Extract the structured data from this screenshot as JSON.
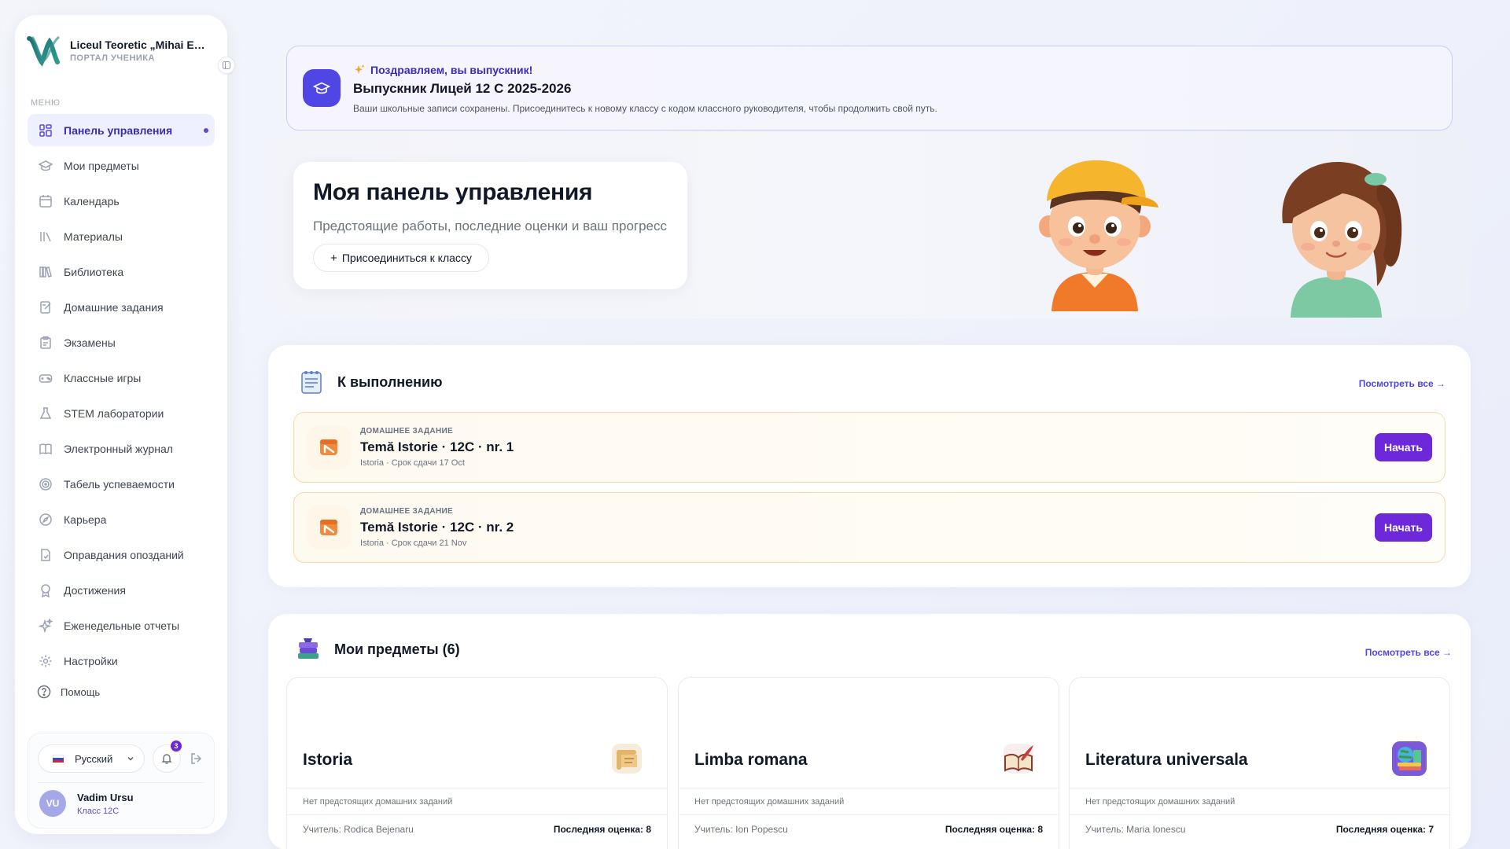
{
  "sidebar": {
    "school_name": "Liceul Teoretic „Mihai Emi...",
    "portal_label": "ПОРТАЛ УЧЕНИКА",
    "menu_label": "МЕНЮ",
    "items": [
      {
        "label": "Панель управления",
        "icon": "dashboard-icon",
        "active": true
      },
      {
        "label": "Мои предметы",
        "icon": "graduation-cap-icon"
      },
      {
        "label": "Календарь",
        "icon": "calendar-icon"
      },
      {
        "label": "Материалы",
        "icon": "materials-icon"
      },
      {
        "label": "Библиотека",
        "icon": "library-icon"
      },
      {
        "label": "Домашние задания",
        "icon": "homework-icon"
      },
      {
        "label": "Экзамены",
        "icon": "clipboard-icon"
      },
      {
        "label": "Классные игры",
        "icon": "gamepad-icon"
      },
      {
        "label": "STEM лаборатории",
        "icon": "flask-icon"
      },
      {
        "label": "Электронный журнал",
        "icon": "book-open-icon"
      },
      {
        "label": "Табель успеваемости",
        "icon": "target-icon"
      },
      {
        "label": "Карьера",
        "icon": "compass-icon"
      },
      {
        "label": "Оправдания опозданий",
        "icon": "document-icon"
      },
      {
        "label": "Достижения",
        "icon": "award-icon"
      },
      {
        "label": "Еженедельные отчеты",
        "icon": "sparkles-icon"
      },
      {
        "label": "Настройки",
        "icon": "gear-icon"
      }
    ],
    "help_label": "Помощь",
    "language": "Русский",
    "notification_count": "3",
    "user": {
      "initials": "VU",
      "name": "Vadim Ursu",
      "class": "Класс 12C"
    }
  },
  "graduation_banner": {
    "congrats": "Поздравляем, вы выпускник!",
    "title": "Выпускник Лицей 12 C 2025-2026",
    "description": "Ваши школьные записи сохранены. Присоединитесь к новому классу с кодом классного руководителя, чтобы продолжить свой путь."
  },
  "hero": {
    "title": "Моя панель управления",
    "subtitle": "Предстоящие работы, последние оценки и ваш прогресс",
    "join_button": "Присоединиться к классу"
  },
  "todo": {
    "title": "К выполнению",
    "view_all": "Посмотреть все →",
    "tasks": [
      {
        "type": "ДОМАШНЕЕ ЗАДАНИЕ",
        "name": "Temă Istorie · 12C · nr. 1",
        "meta": "Istoria · Срок сдачи 17 Oct",
        "button": "Начать"
      },
      {
        "type": "ДОМАШНЕЕ ЗАДАНИЕ",
        "name": "Temă Istorie · 12C · nr. 2",
        "meta": "Istoria · Срок сдачи 21 Nov",
        "button": "Начать"
      }
    ]
  },
  "subjects": {
    "title": "Мои предметы (6)",
    "view_all": "Посмотреть все →",
    "cards": [
      {
        "name": "Istoria",
        "icon": "scroll-icon",
        "homework": "Нет предстоящих домашних заданий",
        "teacher": "Учитель: Rodica Bejenaru",
        "grade": "Последняя оценка: 8"
      },
      {
        "name": "Limba romana",
        "icon": "quill-book-icon",
        "homework": "Нет предстоящих домашних заданий",
        "teacher": "Учитель: Ion Popescu",
        "grade": "Последняя оценка: 8"
      },
      {
        "name": "Literatura universala",
        "icon": "globe-books-icon",
        "homework": "Нет предстоящих домашних заданий",
        "teacher": "Учитель: Maria Ionescu",
        "grade": "Последняя оценка: 7"
      }
    ]
  },
  "colors": {
    "accent": "#6d28d9",
    "active_nav": "#eef0ff",
    "brand_indigo": "#4f46e5"
  }
}
